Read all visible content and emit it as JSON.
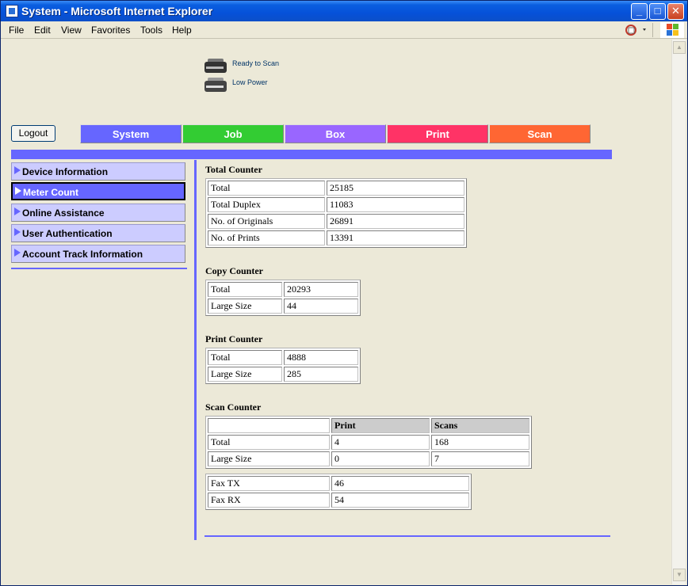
{
  "window": {
    "title": "System - Microsoft Internet Explorer"
  },
  "menu": {
    "file": "File",
    "edit": "Edit",
    "view": "View",
    "favorites": "Favorites",
    "tools": "Tools",
    "help": "Help"
  },
  "status": [
    {
      "label": "Ready to Scan"
    },
    {
      "label": "Low Power"
    }
  ],
  "logout_label": "Logout",
  "tabs": [
    {
      "label": "System",
      "color": "#6666ff"
    },
    {
      "label": "Job",
      "color": "#33cc33"
    },
    {
      "label": "Box",
      "color": "#9966ff"
    },
    {
      "label": "Print",
      "color": "#ff3366"
    },
    {
      "label": "Scan",
      "color": "#ff6633"
    }
  ],
  "sidebar": {
    "items": [
      {
        "label": "Device Information",
        "active": false
      },
      {
        "label": "Meter Count",
        "active": true
      },
      {
        "label": "Online Assistance",
        "active": false
      },
      {
        "label": "User Authentication",
        "active": false
      },
      {
        "label": "Account Track Information",
        "active": false
      }
    ]
  },
  "total_counter": {
    "title": "Total Counter",
    "rows": [
      {
        "label": "Total",
        "value": "25185"
      },
      {
        "label": "Total Duplex",
        "value": "11083"
      },
      {
        "label": "No. of Originals",
        "value": "26891"
      },
      {
        "label": "No. of Prints",
        "value": "13391"
      }
    ]
  },
  "copy_counter": {
    "title": "Copy Counter",
    "rows": [
      {
        "label": "Total",
        "value": "20293"
      },
      {
        "label": "Large Size",
        "value": "44"
      }
    ]
  },
  "print_counter": {
    "title": "Print Counter",
    "rows": [
      {
        "label": "Total",
        "value": "4888"
      },
      {
        "label": "Large Size",
        "value": "285"
      }
    ]
  },
  "scan_counter": {
    "title": "Scan Counter",
    "headers": {
      "blank": "",
      "print": "Print",
      "scans": "Scans"
    },
    "rows": [
      {
        "label": "Total",
        "print": "4",
        "scans": "168"
      },
      {
        "label": "Large Size",
        "print": "0",
        "scans": "7"
      }
    ],
    "fax": [
      {
        "label": "Fax TX",
        "value": "46"
      },
      {
        "label": "Fax RX",
        "value": "54"
      }
    ]
  }
}
